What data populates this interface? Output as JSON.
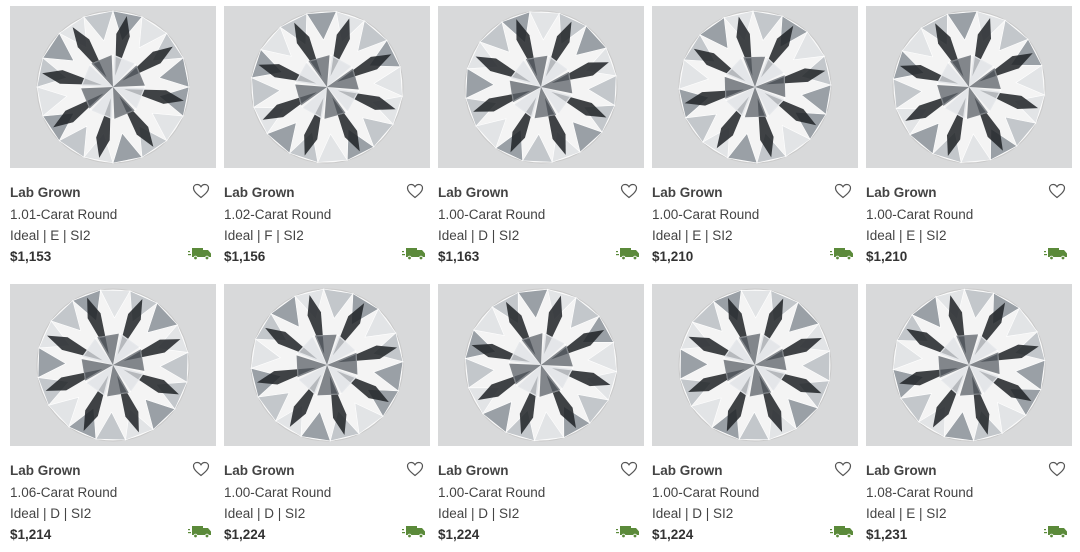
{
  "colors": {
    "tile_bg": "#d8d9da",
    "truck": "#5b8a3a",
    "text": "#444444"
  },
  "products": [
    {
      "type": "Lab Grown",
      "name": "1.01-Carat Round",
      "specs": "Ideal | E | SI2",
      "price": "$1,153",
      "icon_wishlist": "heart-icon",
      "icon_shipping": "truck-icon"
    },
    {
      "type": "Lab Grown",
      "name": "1.02-Carat Round",
      "specs": "Ideal | F | SI2",
      "price": "$1,156",
      "icon_wishlist": "heart-icon",
      "icon_shipping": "truck-icon"
    },
    {
      "type": "Lab Grown",
      "name": "1.00-Carat Round",
      "specs": "Ideal | D | SI2",
      "price": "$1,163",
      "icon_wishlist": "heart-icon",
      "icon_shipping": "truck-icon"
    },
    {
      "type": "Lab Grown",
      "name": "1.00-Carat Round",
      "specs": "Ideal | E | SI2",
      "price": "$1,210",
      "icon_wishlist": "heart-icon",
      "icon_shipping": "truck-icon"
    },
    {
      "type": "Lab Grown",
      "name": "1.00-Carat Round",
      "specs": "Ideal | E | SI2",
      "price": "$1,210",
      "icon_wishlist": "heart-icon",
      "icon_shipping": "truck-icon"
    },
    {
      "type": "Lab Grown",
      "name": "1.06-Carat Round",
      "specs": "Ideal | D | SI2",
      "price": "$1,214",
      "icon_wishlist": "heart-icon",
      "icon_shipping": "truck-icon"
    },
    {
      "type": "Lab Grown",
      "name": "1.00-Carat Round",
      "specs": "Ideal | D | SI2",
      "price": "$1,224",
      "icon_wishlist": "heart-icon",
      "icon_shipping": "truck-icon"
    },
    {
      "type": "Lab Grown",
      "name": "1.00-Carat Round",
      "specs": "Ideal | D | SI2",
      "price": "$1,224",
      "icon_wishlist": "heart-icon",
      "icon_shipping": "truck-icon"
    },
    {
      "type": "Lab Grown",
      "name": "1.00-Carat Round",
      "specs": "Ideal | D | SI2",
      "price": "$1,224",
      "icon_wishlist": "heart-icon",
      "icon_shipping": "truck-icon"
    },
    {
      "type": "Lab Grown",
      "name": "1.08-Carat Round",
      "specs": "Ideal | E | SI2",
      "price": "$1,231",
      "icon_wishlist": "heart-icon",
      "icon_shipping": "truck-icon"
    }
  ]
}
